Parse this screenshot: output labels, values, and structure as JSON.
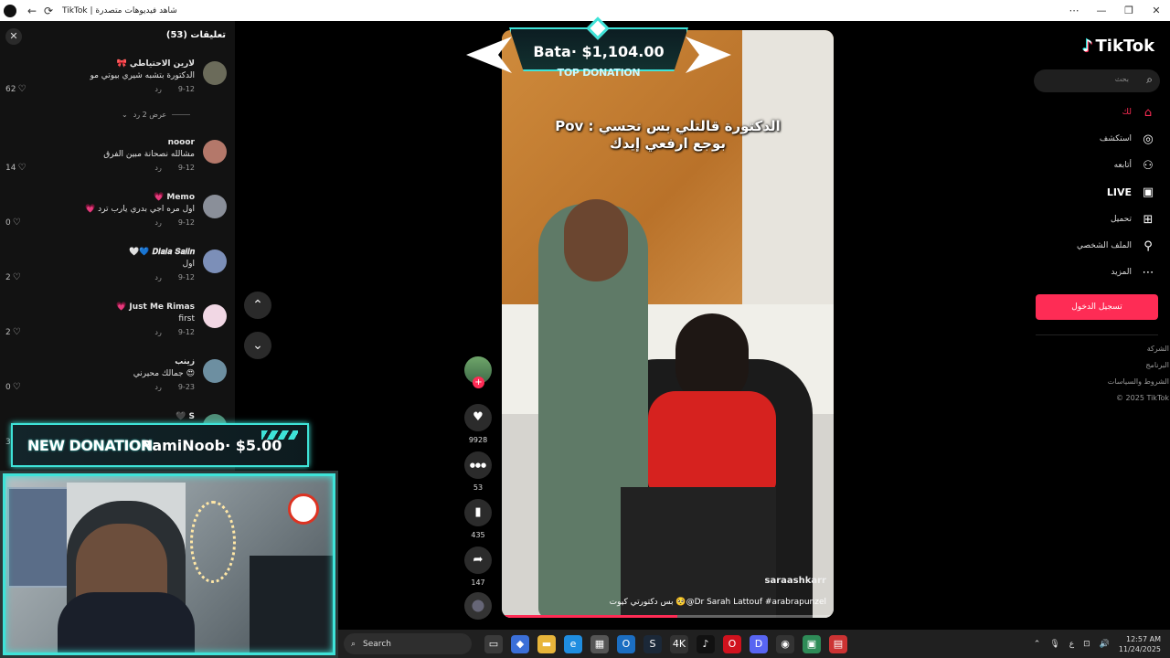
{
  "browser": {
    "title": "TikTok | شاهد فيديوهات متصدرة",
    "back": "←",
    "reload": "⟳",
    "minimize": "—",
    "restore": "❐",
    "close": "✕",
    "menu": "⋯"
  },
  "comments_panel": {
    "title": "تعليقات (53)",
    "close_icon": "✕",
    "reply_label": "رد",
    "view_replies": "عرض 2 رد",
    "items": [
      {
        "user": "لارين الاحتياطي 🎀",
        "text": "الدكتورة بتشبه شيري بيوتي مو",
        "date": "9-12",
        "likes": "62",
        "avatar_color": "#6b6b5a"
      },
      {
        "user": "nooor",
        "text": "مشالله نصحانة مبين الفرق",
        "date": "9-12",
        "likes": "14",
        "avatar_color": "#b4786a"
      },
      {
        "user": "Memo 💗",
        "text": "اول مره اجي بدري يارب ترد 💗",
        "date": "9-12",
        "likes": "0",
        "avatar_color": "#8a8f99"
      },
      {
        "user": "𝑫𝒊𝒂𝒍𝒂 𝑺𝒂𝒍𝒊𝒏 💙🤍",
        "text": "اول",
        "date": "9-12",
        "likes": "2",
        "avatar_color": "#7c8fb8"
      },
      {
        "user": "Just Me Rimas 💗",
        "text": "first",
        "date": "9-12",
        "likes": "2",
        "avatar_color": "#f1d7e4"
      },
      {
        "user": "زينب",
        "text": "😍 جمالك محيرني",
        "date": "9-23",
        "likes": "0",
        "avatar_color": "#6d8fa1"
      },
      {
        "user": "S 🖤",
        "text": "",
        "date": "",
        "likes": "3",
        "avatar_color": "#4f8d77"
      }
    ]
  },
  "scroll": {
    "up_icon": "⌃",
    "down_icon": "⌄"
  },
  "donation_new": {
    "label": "NEW DONATION",
    "text": "RamiNoob· $5.00"
  },
  "donation_top": {
    "name": "Bata· $1,104.00",
    "label": "TOP DONATION"
  },
  "video": {
    "caption_line1": "الدكتورة قالتلي بس تحسي : Pov",
    "caption_line2": "بوجع ارفعي إيدك",
    "author": "saraashkarr",
    "description": "بس دكتورتي كيوت 🥺@Dr Sarah Lattouf #arabrapunzel",
    "progress": 0.53
  },
  "actions": {
    "like_icon": "♥",
    "like_count": "9928",
    "comment_icon": "●●●",
    "comment_count": "53",
    "save_icon": "▮",
    "save_count": "435",
    "share_icon": "➦",
    "share_count": "147",
    "follow_icon": "+"
  },
  "sidebar": {
    "logo": "TikTok",
    "logo_icon": "♪",
    "search_placeholder": "بحث",
    "search_icon": "⌕",
    "nav": [
      {
        "label": "لك",
        "icon": "⌂",
        "active": true
      },
      {
        "label": "استكشف",
        "icon": "◎",
        "active": false
      },
      {
        "label": "أتابعه",
        "icon": "⚇",
        "active": false
      },
      {
        "label": "LIVE",
        "icon": "▣",
        "active": false
      },
      {
        "label": "تحميل",
        "icon": "⊞",
        "active": false
      },
      {
        "label": "الملف الشخصي",
        "icon": "⚲",
        "active": false
      },
      {
        "label": "المزيد",
        "icon": "⋯",
        "active": false
      }
    ],
    "login": "تسجيل الدخول",
    "footer": [
      "الشركة",
      "البرنامج",
      "الشروط والسياسات",
      "© 2025 TikTok"
    ]
  },
  "taskbar": {
    "search": "Search",
    "search_icon": "⌕",
    "apps": [
      {
        "name": "task-view",
        "glyph": "▭",
        "color": "#3a3a3a"
      },
      {
        "name": "store",
        "glyph": "◆",
        "color": "#3b6fd8"
      },
      {
        "name": "files",
        "glyph": "▬",
        "color": "#e8b53a"
      },
      {
        "name": "edge",
        "glyph": "e",
        "color": "#1f8de0"
      },
      {
        "name": "ms-store",
        "glyph": "▦",
        "color": "#555"
      },
      {
        "name": "outlook",
        "glyph": "O",
        "color": "#1b6ec2"
      },
      {
        "name": "steam",
        "glyph": "S",
        "color": "#1b2838"
      },
      {
        "name": "4k",
        "glyph": "4K",
        "color": "#333"
      },
      {
        "name": "tiktok",
        "glyph": "♪",
        "color": "#111"
      },
      {
        "name": "opera",
        "glyph": "O",
        "color": "#d0121e"
      },
      {
        "name": "discord",
        "glyph": "D",
        "color": "#5865f2"
      },
      {
        "name": "obs",
        "glyph": "◉",
        "color": "#333"
      },
      {
        "name": "chat",
        "glyph": "▣",
        "color": "#2e8b57"
      },
      {
        "name": "app",
        "glyph": "▤",
        "color": "#c33"
      }
    ],
    "tray_up": "⌃",
    "mic_icon": "🎙",
    "lang": "ع",
    "wifi": "⊡",
    "volume": "🔊",
    "time": "12:57 AM",
    "date": "11/24/2025"
  }
}
